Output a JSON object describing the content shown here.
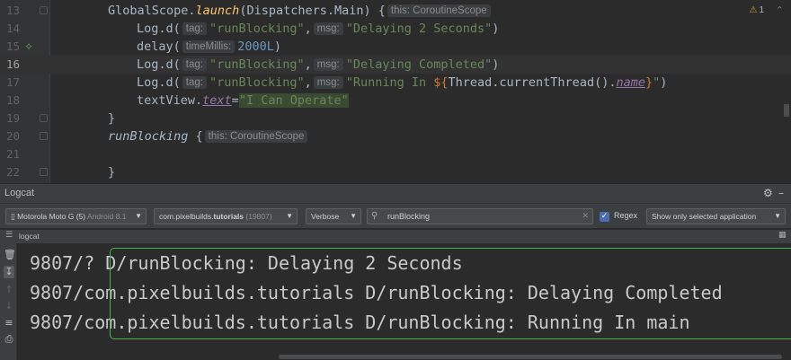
{
  "editor": {
    "lines": [
      {
        "num": "13",
        "current": false
      },
      {
        "num": "14",
        "current": false
      },
      {
        "num": "15",
        "current": false
      },
      {
        "num": "16",
        "current": true
      },
      {
        "num": "17",
        "current": false
      },
      {
        "num": "18",
        "current": false
      },
      {
        "num": "19",
        "current": false
      },
      {
        "num": "20",
        "current": false
      },
      {
        "num": "21",
        "current": false
      },
      {
        "num": "22",
        "current": false
      }
    ],
    "code": {
      "l13_scope": "GlobalScope.",
      "l13_launch": "launch",
      "l13_args": "(Dispatchers.Main) {",
      "l13_hint": "this: CoroutineScope",
      "l14_fn": "Log.d(",
      "l14_tag_hint": "tag:",
      "l14_tag": "\"runBlocking\"",
      "l14_sep": ",",
      "l14_msg_hint": "msg:",
      "l14_msg": "\"Delaying 2 Seconds\"",
      "l14_end": ")",
      "l15_fn": "delay(",
      "l15_hint": "timeMillis:",
      "l15_num": "2000L",
      "l15_end": ")",
      "l16_fn": "Log.d(",
      "l16_tag_hint": "tag:",
      "l16_tag": "\"runBlocking\"",
      "l16_sep": ",",
      "l16_msg_hint": "msg:",
      "l16_msg": "\"Delaying Completed\"",
      "l16_end": ")",
      "l17_fn": "Log.d(",
      "l17_tag_hint": "tag:",
      "l17_tag": "\"runBlocking\"",
      "l17_sep": ",",
      "l17_msg_hint": "msg:",
      "l17_msg_a": "\"Running In ",
      "l17_msg_b": "${",
      "l17_msg_c": "Thread.currentThread().",
      "l17_msg_d": "name",
      "l17_msg_e": "}",
      "l17_msg_f": "\"",
      "l17_end": ")",
      "l18_obj": "textView.",
      "l18_prop": "text",
      "l18_eq": "=",
      "l18_str": "\"I Can Operate\"",
      "l19": "}",
      "l20_fn": "runBlocking",
      "l20_brace": " {",
      "l20_hint": "this: CoroutineScope",
      "l22": "}"
    },
    "warning_count": "1"
  },
  "logcat": {
    "title": "Logcat",
    "device": {
      "name": "Motorola Moto G (5)",
      "detail": "Android 8.1"
    },
    "process": {
      "prefix": "com.pixelbuilds.",
      "bold": "tutorials",
      "pid": "(19807)"
    },
    "level": "Verbose",
    "search": {
      "value": "runBlocking"
    },
    "regex_label": "Regex",
    "filter": "Show only selected application",
    "section_label": "logcat",
    "lines": [
      "9807/? D/runBlocking: Delaying 2 Seconds",
      "9807/com.pixelbuilds.tutorials D/runBlocking: Delaying Completed",
      "9807/com.pixelbuilds.tutorials D/runBlocking: Running In main"
    ]
  },
  "colors": {
    "editor_bg": "#2b2b2b",
    "keyword_fn": "#ffc66d",
    "string": "#6a8759",
    "number": "#6897bb",
    "highlight_border": "#4cb34a"
  }
}
